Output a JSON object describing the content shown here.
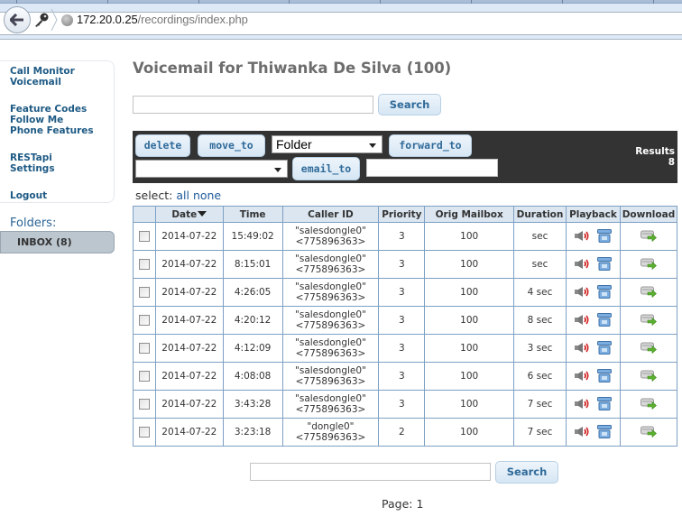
{
  "browser": {
    "url_host": "172.20.0.25",
    "url_path": "/recordings/index.php"
  },
  "sidebar": {
    "groups": [
      [
        "Call Monitor",
        "Voicemail"
      ],
      [
        "Feature Codes",
        "Follow Me",
        "Phone Features"
      ],
      [
        "RESTapi",
        "Settings"
      ],
      [
        "Logout"
      ]
    ],
    "folders_label": "Folders:",
    "inbox_label": "INBOX (8)"
  },
  "main": {
    "title": "Voicemail for Thiwanka De Silva (100)",
    "top_search": {
      "value": "",
      "button": "Search"
    },
    "toolbar": {
      "delete": "delete",
      "move_to": "move_to",
      "folder_select": "Folder",
      "forward_to": "forward_to",
      "forward_select": "",
      "email_to": "email_to",
      "email_value": "",
      "results_label": "Results",
      "results_count": "8"
    },
    "select": {
      "label": "select:",
      "all": "all",
      "none": "none"
    },
    "table": {
      "headers": [
        "",
        "Date",
        "Time",
        "Caller ID",
        "Priority",
        "Orig Mailbox",
        "Duration",
        "Playback",
        "Download"
      ],
      "rows": [
        {
          "date": "2014-07-22",
          "time": "15:49:02",
          "caller_name": "\"salesdongle0\"",
          "caller_num": "<775896363>",
          "priority": "3",
          "mailbox": "100",
          "duration": "sec"
        },
        {
          "date": "2014-07-22",
          "time": "8:15:01",
          "caller_name": "\"salesdongle0\"",
          "caller_num": "<775896363>",
          "priority": "3",
          "mailbox": "100",
          "duration": "sec"
        },
        {
          "date": "2014-07-22",
          "time": "4:26:05",
          "caller_name": "\"salesdongle0\"",
          "caller_num": "<775896363>",
          "priority": "3",
          "mailbox": "100",
          "duration": "4 sec"
        },
        {
          "date": "2014-07-22",
          "time": "4:20:12",
          "caller_name": "\"salesdongle0\"",
          "caller_num": "<775896363>",
          "priority": "3",
          "mailbox": "100",
          "duration": "8 sec"
        },
        {
          "date": "2014-07-22",
          "time": "4:12:09",
          "caller_name": "\"salesdongle0\"",
          "caller_num": "<775896363>",
          "priority": "3",
          "mailbox": "100",
          "duration": "3 sec"
        },
        {
          "date": "2014-07-22",
          "time": "4:08:08",
          "caller_name": "\"salesdongle0\"",
          "caller_num": "<775896363>",
          "priority": "3",
          "mailbox": "100",
          "duration": "6 sec"
        },
        {
          "date": "2014-07-22",
          "time": "3:43:28",
          "caller_name": "\"salesdongle0\"",
          "caller_num": "<775896363>",
          "priority": "3",
          "mailbox": "100",
          "duration": "7 sec"
        },
        {
          "date": "2014-07-22",
          "time": "3:23:18",
          "caller_name": "\"dongle0\"",
          "caller_num": "<775896363>",
          "priority": "2",
          "mailbox": "100",
          "duration": "7 sec"
        }
      ]
    },
    "bottom_search": {
      "value": "",
      "button": "Search"
    },
    "page_label": "Page: 1"
  }
}
